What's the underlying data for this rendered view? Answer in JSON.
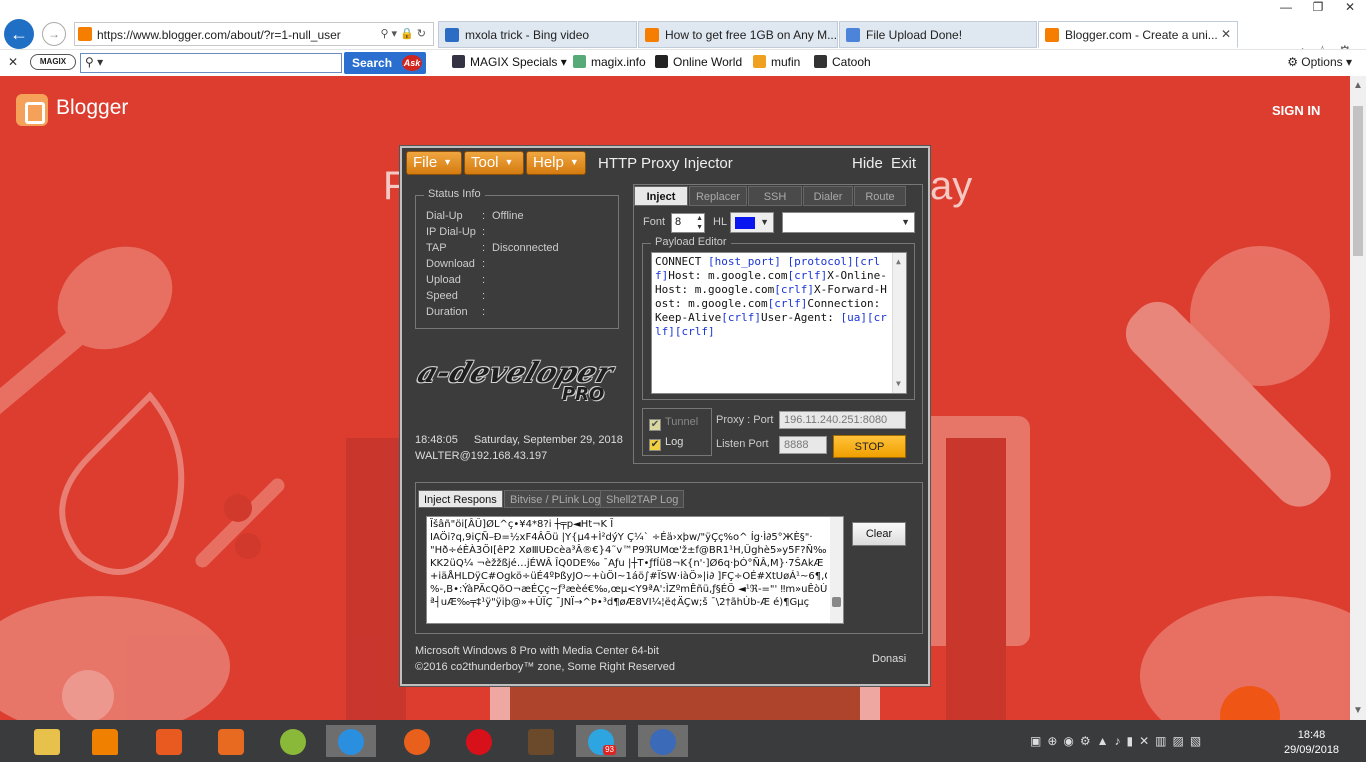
{
  "browser": {
    "url": "https://www.blogger.com/about/?r=1-null_user",
    "tabs": [
      {
        "label": "mxola trick - Bing video",
        "color": "#2b6cc4"
      },
      {
        "label": "How to get free 1GB on Any M...",
        "color": "#f57d00"
      },
      {
        "label": "File Upload Done!",
        "color": "#4b84d8"
      },
      {
        "label": "Blogger.com - Create a uni...",
        "color": "#f57d00",
        "active": true
      }
    ],
    "search_button": "Search",
    "ask_label": "Ask",
    "magix_label": "MAGIX",
    "toolbar_links": [
      "MAGIX Specials",
      "magix.info",
      "Online World",
      "mufin",
      "Catooh"
    ],
    "options_label": "Options"
  },
  "page": {
    "brand": "Blogger",
    "signin": "SIGN IN",
    "hero_left": "F",
    "hero_right": "ay"
  },
  "injector": {
    "menus": [
      "File",
      "Tool",
      "Help"
    ],
    "title": "HTTP Proxy Injector",
    "hide": "Hide",
    "exit": "Exit",
    "status_title": "Status Info",
    "status": [
      {
        "label": "Dial-Up",
        "value": "Offline"
      },
      {
        "label": "IP Dial-Up",
        "value": ""
      },
      {
        "label": "TAP",
        "value": "Disconnected"
      },
      {
        "label": "Download",
        "value": ""
      },
      {
        "label": "Upload",
        "value": ""
      },
      {
        "label": "Speed",
        "value": ""
      },
      {
        "label": "Duration",
        "value": ""
      }
    ],
    "logo_main": "a-developer",
    "logo_sub": "PRO",
    "time": "18:48:05",
    "date": "Saturday, September 29, 2018",
    "user": "WALTER@192.168.43.197",
    "tabs": [
      "Inject",
      "Replacer",
      "SSH",
      "Dialer",
      "Route"
    ],
    "font_label": "Font",
    "font_value": "8",
    "hl_label": "HL",
    "hl_color": "#0a16f0",
    "payload_title": "Payload Editor",
    "payload": [
      {
        "t": "CONNECT ",
        "k": false
      },
      {
        "t": "[host_port] [protocol][crlf]",
        "k": true
      },
      {
        "t": "Host: m.google.com",
        "k": false
      },
      {
        "t": "[crlf]",
        "k": true
      },
      {
        "t": "X-Online-Host: m.google.com",
        "k": false
      },
      {
        "t": "[crlf]",
        "k": true
      },
      {
        "t": "X-Forward-Host: m.google.com",
        "k": false
      },
      {
        "t": "[crlf]",
        "k": true
      },
      {
        "t": "Connection: Keep-Alive",
        "k": false
      },
      {
        "t": "[crlf]",
        "k": true
      },
      {
        "t": "User-Agent: ",
        "k": false
      },
      {
        "t": "[ua][crlf][crlf]",
        "k": true
      }
    ],
    "tunnel_label": "Tunnel",
    "log_label": "Log",
    "proxy_label": "Proxy : Port",
    "proxy_value": "196.11.240.251:8080",
    "listen_label": "Listen Port",
    "listen_value": "8888",
    "stop_label": "STOP",
    "log_tabs": [
      "Inject Respons",
      "Bitvise / PLink Log",
      "Shell2TAP Log"
    ],
    "log_lines": [
      "Ĭšâñ\"öi[ÂÛ]ØL^ç•¥4*8?i ┼╤p◄Ht¬K Ĭ",
      "IAÖi?q,9iÇÑ–Ð=½xF4ÂÕü |Y{µ4+Ì²dýY Ç¼` ÷Éä›xþw/\"ÿÇç%o^  Íg·Ì∂5°ЖÈ§\"·",
      "\"Hð÷éÈÀ3ÖI[êP2   XøⅢUÐcèa³Â®€}4˜v™P9ℜUMœ'ž±f@BR1¹H,Ûghè5»y5F?Ñ‰,J",
      "KK2üQ¼    ¬èžžßjé…jÉWÂ ÎQ0DE‰ ¯Aƒu |┼T•ƒfÍü8¬K{n'·]Ø6q·þÓ°ÑÂ,M}·7ŠAkÆ",
      "+iäÅHLDÿC#Ogkö÷üÉ4ºÞßyJO~+ùÖI~1áö∫#ÏSW·iàÖ»|i∂ ]FÇ÷OÉ#XtUøÁ¹~6¶,G/",
      "%-,B•:ÝàPÄcQõO¬æÉÇç~ƒ³æèé€‰,œµ<Y9ªA':ÌZºmÊñü,ƒ§ÉÖ ◄¹ℜ-=\"' ‼m»uÊòÙÖ:",
      "ª┤uÆ‰╤‡¹ÿ\"ÿiþ@»+ÛÏÇ ¯JNÏ→^Þ•³d¶øÆ8VI¼¦ë¢ÄÇw;š ¯\\2†ãhÙb-Æ   é)¶Gµç"
    ],
    "clear_label": "Clear",
    "os": "Microsoft Windows 8 Pro with Media Center 64-bit",
    "copyright": "©2016 co2thunderboy™ zone, Some Right Reserved",
    "donasi": "Donasi"
  },
  "taskbar": {
    "time": "18:48",
    "date": "29/09/2018",
    "telegram_badge": "93"
  }
}
